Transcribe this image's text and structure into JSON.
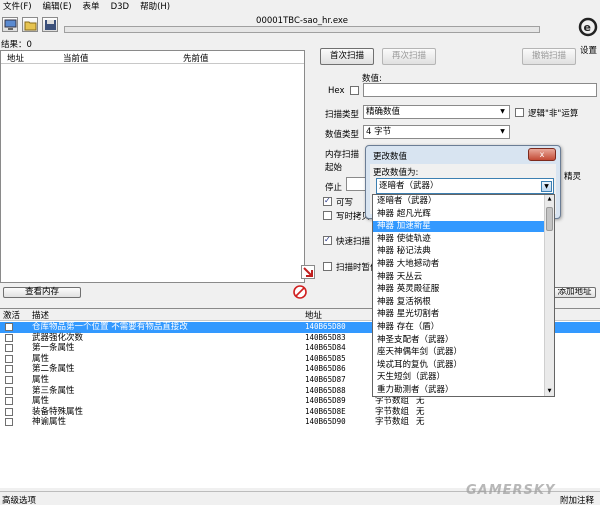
{
  "menu": [
    "文件(F)",
    "编辑(E)",
    "表单",
    "D3D",
    "帮助(H)"
  ],
  "window": {
    "process": "00001TBC-sao_hr.exe",
    "settings_label": "设置"
  },
  "results_label": "结果：0",
  "address_list": {
    "columns": [
      "地址",
      "当前值",
      "先前值"
    ]
  },
  "scan": {
    "first_scan": "首次扫描",
    "next_scan": "再次扫描",
    "undo_scan": "撤销扫描",
    "value_label": "数值:",
    "hex_label": "Hex",
    "scan_type_label": "扫描类型",
    "scan_type_value": "精确数值",
    "not_operator_label": "逻辑\"非\"运算",
    "value_type_label": "数值类型",
    "value_type_value": "4 字节",
    "mem_options_label": "内存扫描",
    "start_label": "起始",
    "stop_label": "停止",
    "writable_label": "可写",
    "copy_on_write_label": "写时拷贝",
    "fast_scan_label": "快速扫描",
    "pause_label": "扫描时暂停",
    "random_label": "精灵"
  },
  "view_memory_button": "查看内存",
  "add_address_button": "添加地址",
  "cheat_table": {
    "columns": [
      "激活",
      "描述",
      "地址",
      "类型",
      "数值"
    ],
    "rows": [
      {
        "desc": "仓库物品第一个位置 不需要有物品直接改",
        "addr": "140B65D80",
        "type": "",
        "value": ""
      },
      {
        "desc": "武器强化次数",
        "addr": "140B65D83",
        "type": "",
        "value": ""
      },
      {
        "desc": "第一条属性",
        "addr": "140B65D84",
        "type": "",
        "value": ""
      },
      {
        "desc": "属性",
        "addr": "140B65D85",
        "type": "",
        "value": ""
      },
      {
        "desc": "第二条属性",
        "addr": "140B65D86",
        "type": "",
        "value": ""
      },
      {
        "desc": "属性",
        "addr": "140B65D87",
        "type": "",
        "value": ""
      },
      {
        "desc": "第三条属性",
        "addr": "140B65D88",
        "type": "",
        "value": ""
      },
      {
        "desc": "属性",
        "addr": "140B65D89",
        "type": "字节数组",
        "value": "无"
      },
      {
        "desc": "装备特殊属性",
        "addr": "140B65D8E",
        "type": "字节数组",
        "value": "无"
      },
      {
        "desc": "神谕属性",
        "addr": "140B65D90",
        "type": "字节数组",
        "value": "无"
      }
    ]
  },
  "status_left": "高级选项",
  "status_right": "附加注释",
  "dialog": {
    "title": "更改数值",
    "close": "x",
    "prompt": "更改数值为:",
    "selected": "逐暗者（武器）",
    "options": [
      "逐暗者（武器）",
      "神器 超凡光辉",
      "神器 加速新星",
      "神器 使徒轨迹",
      "神器 秘记法典",
      "神器 大地撼动者",
      "神器 天丛云",
      "神器 英灵殿征服",
      "神器 复活祸根",
      "神器 星光切割者",
      "神器 存在（盾）",
      "神圣支配者（武器）",
      "座天神偶年剑（武器）",
      "埃忒耳的复仇（武器）",
      "天生短剑（武器）",
      "重力勘测者（武器）"
    ]
  },
  "watermark": "GAMERSKY",
  "colors": {
    "selection": "#3399ff",
    "window_bg": "#f0f0f0",
    "dialog_bg": "#d8e4f1"
  }
}
